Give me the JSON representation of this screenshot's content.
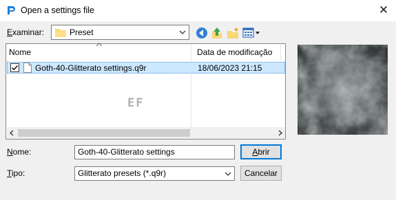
{
  "window": {
    "title": "Open a settings file",
    "close_glyph": "✕"
  },
  "lookin": {
    "label_u": "E",
    "label_rest": "xaminar:",
    "folder": "Preset"
  },
  "filelist": {
    "col_name": "Nome",
    "col_date": "Data de modificação",
    "rows": [
      {
        "name": "Goth-40-Glitterato settings.q9r",
        "date": "18/06/2023 21:15",
        "checked": true,
        "selected": true
      }
    ],
    "watermark": "EF"
  },
  "filename": {
    "label_u": "N",
    "label_rest": "ome:",
    "value": "Goth-40-Glitterato settings"
  },
  "filetype": {
    "label_u": "T",
    "label_rest": "ipo:",
    "value": "Glitterato presets (*.q9r)"
  },
  "buttons": {
    "open_u": "A",
    "open_rest": "brir",
    "cancel": "Cancelar"
  },
  "colors": {
    "accent": "#0078d7",
    "selection": "#cce8ff"
  },
  "icons": [
    "app-icon",
    "folder-icon",
    "back-icon",
    "up-folder-icon",
    "new-folder-icon",
    "view-menu-icon",
    "checkbox-icon",
    "file-icon"
  ]
}
